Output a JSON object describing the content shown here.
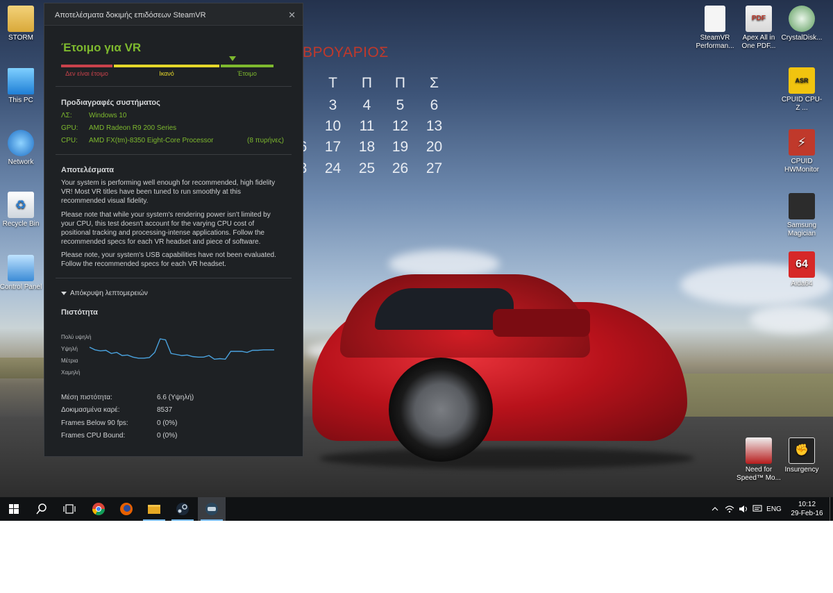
{
  "desktop": {
    "icons_left": [
      {
        "label": "STORM",
        "icon": "folder-icon"
      },
      {
        "label": "This PC",
        "icon": "computer-icon"
      },
      {
        "label": "Network",
        "icon": "network-icon"
      },
      {
        "label": "Recycle Bin",
        "icon": "recycle-bin-icon"
      },
      {
        "label": "Control Panel",
        "icon": "control-panel-icon"
      }
    ],
    "icons_right": [
      {
        "label": "SteamVR Performan...",
        "icon": "document-icon"
      },
      {
        "label": "Apex All in One PDF...",
        "icon": "pdf-icon"
      },
      {
        "label": "CrystalDisk...",
        "icon": "crystaldisk-icon"
      },
      {
        "label": "CPUID CPU-Z ...",
        "icon": "cpuz-icon"
      },
      {
        "label": "CPUID HWMonitor",
        "icon": "hwmonitor-icon"
      },
      {
        "label": "Samsung Magician",
        "icon": "samsung-magician-icon"
      },
      {
        "label": "Aida64",
        "icon": "aida64-icon"
      },
      {
        "label": "Need for Speed™ Mo...",
        "icon": "nfs-icon"
      },
      {
        "label": "Insurgency",
        "icon": "insurgency-icon"
      }
    ]
  },
  "calendar": {
    "month": "ΒΡΟΥΑΡΙΟΣ",
    "day_headers": [
      "Τ",
      "Π",
      "Π",
      "Σ"
    ],
    "weeks": [
      [
        "3",
        "4",
        "5",
        "6"
      ],
      [
        "10",
        "11",
        "12",
        "13"
      ],
      [
        "6",
        "17",
        "18",
        "19",
        "20"
      ],
      [
        "3",
        "24",
        "25",
        "26",
        "27"
      ]
    ]
  },
  "vr_window": {
    "title": "Αποτελέσματα δοκιμής επιδόσεων SteamVR",
    "close_glyph": "✕",
    "verdict": "Έτοιμο για VR",
    "scale": {
      "labels": [
        "Δεν είναι έτοιμο",
        "Ικανό",
        "Έτοιμο"
      ],
      "colors": [
        "#c8424b",
        "#e5d72a",
        "#7eb92e"
      ]
    },
    "specs": {
      "heading": "Προδιαγραφές συστήματος",
      "os_label": "ΛΣ:",
      "os_value": "Windows 10",
      "gpu_label": "GPU:",
      "gpu_value": "AMD Radeon R9 200 Series",
      "cpu_label": "CPU:",
      "cpu_value": "AMD FX(tm)-8350 Eight-Core Processor",
      "cpu_cores": "(8 πυρήνες)"
    },
    "results": {
      "heading": "Αποτελέσματα",
      "p1": "Your system is performing well enough for recommended, high fidelity VR! Most VR titles have been tuned to run smoothly at this recommended visual fidelity.",
      "p2": "Please note that while your system's rendering power isn't limited by your CPU, this test doesn't account for the varying CPU cost of positional tracking and processing-intense applications. Follow the recommended specs for each VR headset and piece of software.",
      "p3": "Please note, your system's USB capabilities have not been evaluated. Follow the recommended specs for each VR headset."
    },
    "details_toggle": "Απόκρυψη λεπτομερειών",
    "fidelity": {
      "heading": "Πιστότητα",
      "levels": [
        "Πολύ υψηλή",
        "Υψηλή",
        "Μέτρια",
        "Χαμηλή"
      ],
      "line_color": "#4aa3df",
      "trace": [
        5.2,
        4.7,
        4.5,
        4.6,
        4.0,
        4.2,
        3.6,
        3.7,
        3.3,
        3.1,
        3.1,
        3.2,
        4.2,
        6.8,
        6.6,
        4.0,
        3.8,
        3.6,
        3.7,
        3.4,
        3.3,
        3.3,
        3.6,
        2.9,
        3.0,
        2.9,
        4.4,
        4.4,
        4.4,
        4.2,
        4.6,
        4.6,
        4.7,
        4.7,
        4.7
      ]
    },
    "stats": [
      {
        "label": "Μέση πιστότητα:",
        "value": "6.6 (Υψηλή)"
      },
      {
        "label": "Δοκιμασμένα καρέ:",
        "value": "8537"
      },
      {
        "label": "Frames Below 90 fps:",
        "value": "0 (0%)"
      },
      {
        "label": "Frames CPU Bound:",
        "value": "0 (0%)"
      }
    ]
  },
  "taskbar": {
    "apps": [
      {
        "name": "start-button",
        "icon": "windows-icon"
      },
      {
        "name": "search-button",
        "icon": "search-icon"
      },
      {
        "name": "task-view-button",
        "icon": "task-view-icon"
      },
      {
        "name": "chrome-button",
        "icon": "chrome-icon"
      },
      {
        "name": "firefox-button",
        "icon": "firefox-icon"
      },
      {
        "name": "file-explorer-button",
        "icon": "folder-icon"
      },
      {
        "name": "steam-button",
        "icon": "steam-icon"
      },
      {
        "name": "steamvr-button",
        "icon": "steamvr-icon"
      }
    ],
    "tray": {
      "language": "ENG",
      "time": "10:12",
      "date": "29-Feb-16"
    }
  }
}
